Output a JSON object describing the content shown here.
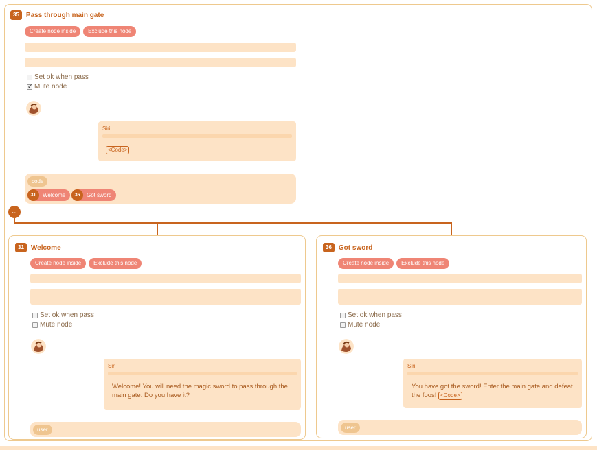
{
  "colors": {
    "accent": "#c8641e",
    "button": "#ef8575",
    "field": "#fde3c6",
    "border": "#eec98e",
    "pill": "#efc590"
  },
  "root_node": {
    "id": "35",
    "title": "Pass through main gate",
    "buttons": {
      "create": "Create node inside",
      "exclude": "Exclude this node"
    },
    "set_ok_label": "Set ok when pass",
    "set_ok_checked": false,
    "mute_label": "Mute node",
    "mute_checked": true,
    "bubble": {
      "speaker": "Siri",
      "code_tag": "<Code>"
    },
    "footer": {
      "type_pill": "code",
      "links": [
        {
          "id": "31",
          "label": "Welcome"
        },
        {
          "id": "36",
          "label": "Got sword"
        }
      ]
    }
  },
  "more_button": "...",
  "child_nodes": [
    {
      "id": "31",
      "title": "Welcome",
      "buttons": {
        "create": "Create node inside",
        "exclude": "Exclude this node"
      },
      "set_ok_label": "Set ok when pass",
      "set_ok_checked": false,
      "mute_label": "Mute node",
      "mute_checked": false,
      "bubble": {
        "speaker": "Siri",
        "text": "Welcome! You will need the magic sword to pass through the main gate. Do you have it?"
      },
      "footer_pill": "user"
    },
    {
      "id": "36",
      "title": "Got sword",
      "buttons": {
        "create": "Create node inside",
        "exclude": "Exclude this node"
      },
      "set_ok_label": "Set ok when pass",
      "set_ok_checked": false,
      "mute_label": "Mute node",
      "mute_checked": false,
      "bubble": {
        "speaker": "Siri",
        "text": "You have got the sword! Enter the main gate and defeat the foos!",
        "code_tag": "<Code>"
      },
      "footer_pill": "user"
    }
  ]
}
